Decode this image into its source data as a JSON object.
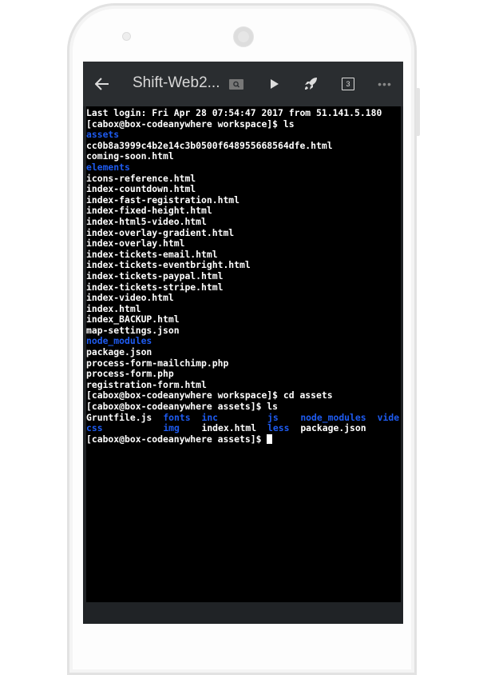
{
  "app": {
    "title": "Shift-Web2...",
    "tabs_count": "3"
  },
  "icons": [
    "back-arrow-icon",
    "search-icon",
    "play-icon",
    "rocket-icon",
    "tabs-icon",
    "more-icon"
  ],
  "colors": {
    "directory": "#1e5bf0",
    "file": "#ffffff",
    "terminal_bg": "#000000",
    "toolbar_bg": "#2a2d30"
  },
  "terminal": {
    "lines": [
      {
        "text": "Last login: Fri Apr 28 07:54:47 2017 from 51.141.5.180",
        "type": "file"
      },
      {
        "text": "[cabox@box-codeanywhere workspace]$ ls",
        "type": "file"
      },
      {
        "text": "assets",
        "type": "dir"
      },
      {
        "text": "cc0b8a3999c4b2e14c3b0500f648955668564dfe.html",
        "type": "file"
      },
      {
        "text": "coming-soon.html",
        "type": "file"
      },
      {
        "text": "elements",
        "type": "dir"
      },
      {
        "text": "icons-reference.html",
        "type": "file"
      },
      {
        "text": "index-countdown.html",
        "type": "file"
      },
      {
        "text": "index-fast-registration.html",
        "type": "file"
      },
      {
        "text": "index-fixed-height.html",
        "type": "file"
      },
      {
        "text": "index-html5-video.html",
        "type": "file"
      },
      {
        "text": "index-overlay-gradient.html",
        "type": "file"
      },
      {
        "text": "index-overlay.html",
        "type": "file"
      },
      {
        "text": "index-tickets-email.html",
        "type": "file"
      },
      {
        "text": "index-tickets-eventbright.html",
        "type": "file"
      },
      {
        "text": "index-tickets-paypal.html",
        "type": "file"
      },
      {
        "text": "index-tickets-stripe.html",
        "type": "file"
      },
      {
        "text": "index-video.html",
        "type": "file"
      },
      {
        "text": "index.html",
        "type": "file"
      },
      {
        "text": "index_BACKUP.html",
        "type": "file"
      },
      {
        "text": "map-settings.json",
        "type": "file"
      },
      {
        "text": "node_modules",
        "type": "dir"
      },
      {
        "text": "package.json",
        "type": "file"
      },
      {
        "text": "process-form-mailchimp.php",
        "type": "file"
      },
      {
        "text": "process-form.php",
        "type": "file"
      },
      {
        "text": "registration-form.html",
        "type": "file"
      },
      {
        "text": "[cabox@box-codeanywhere workspace]$ cd assets",
        "type": "file"
      },
      {
        "text": "[cabox@box-codeanywhere assets]$ ls",
        "type": "file"
      }
    ],
    "grid": [
      [
        {
          "text": "Gruntfile.js",
          "type": "file"
        },
        {
          "text": "fonts",
          "type": "dir"
        },
        {
          "text": "inc",
          "type": "dir"
        },
        {
          "text": "js",
          "type": "dir"
        },
        {
          "text": "node_modules",
          "type": "dir"
        },
        {
          "text": "vide",
          "type": "dir"
        }
      ],
      [
        {
          "text": "css",
          "type": "dir"
        },
        {
          "text": "img",
          "type": "dir"
        },
        {
          "text": "index.html",
          "type": "file"
        },
        {
          "text": "less",
          "type": "dir"
        },
        {
          "text": "package.json",
          "type": "file"
        }
      ]
    ],
    "prompt": "[cabox@box-codeanywhere assets]$ "
  }
}
